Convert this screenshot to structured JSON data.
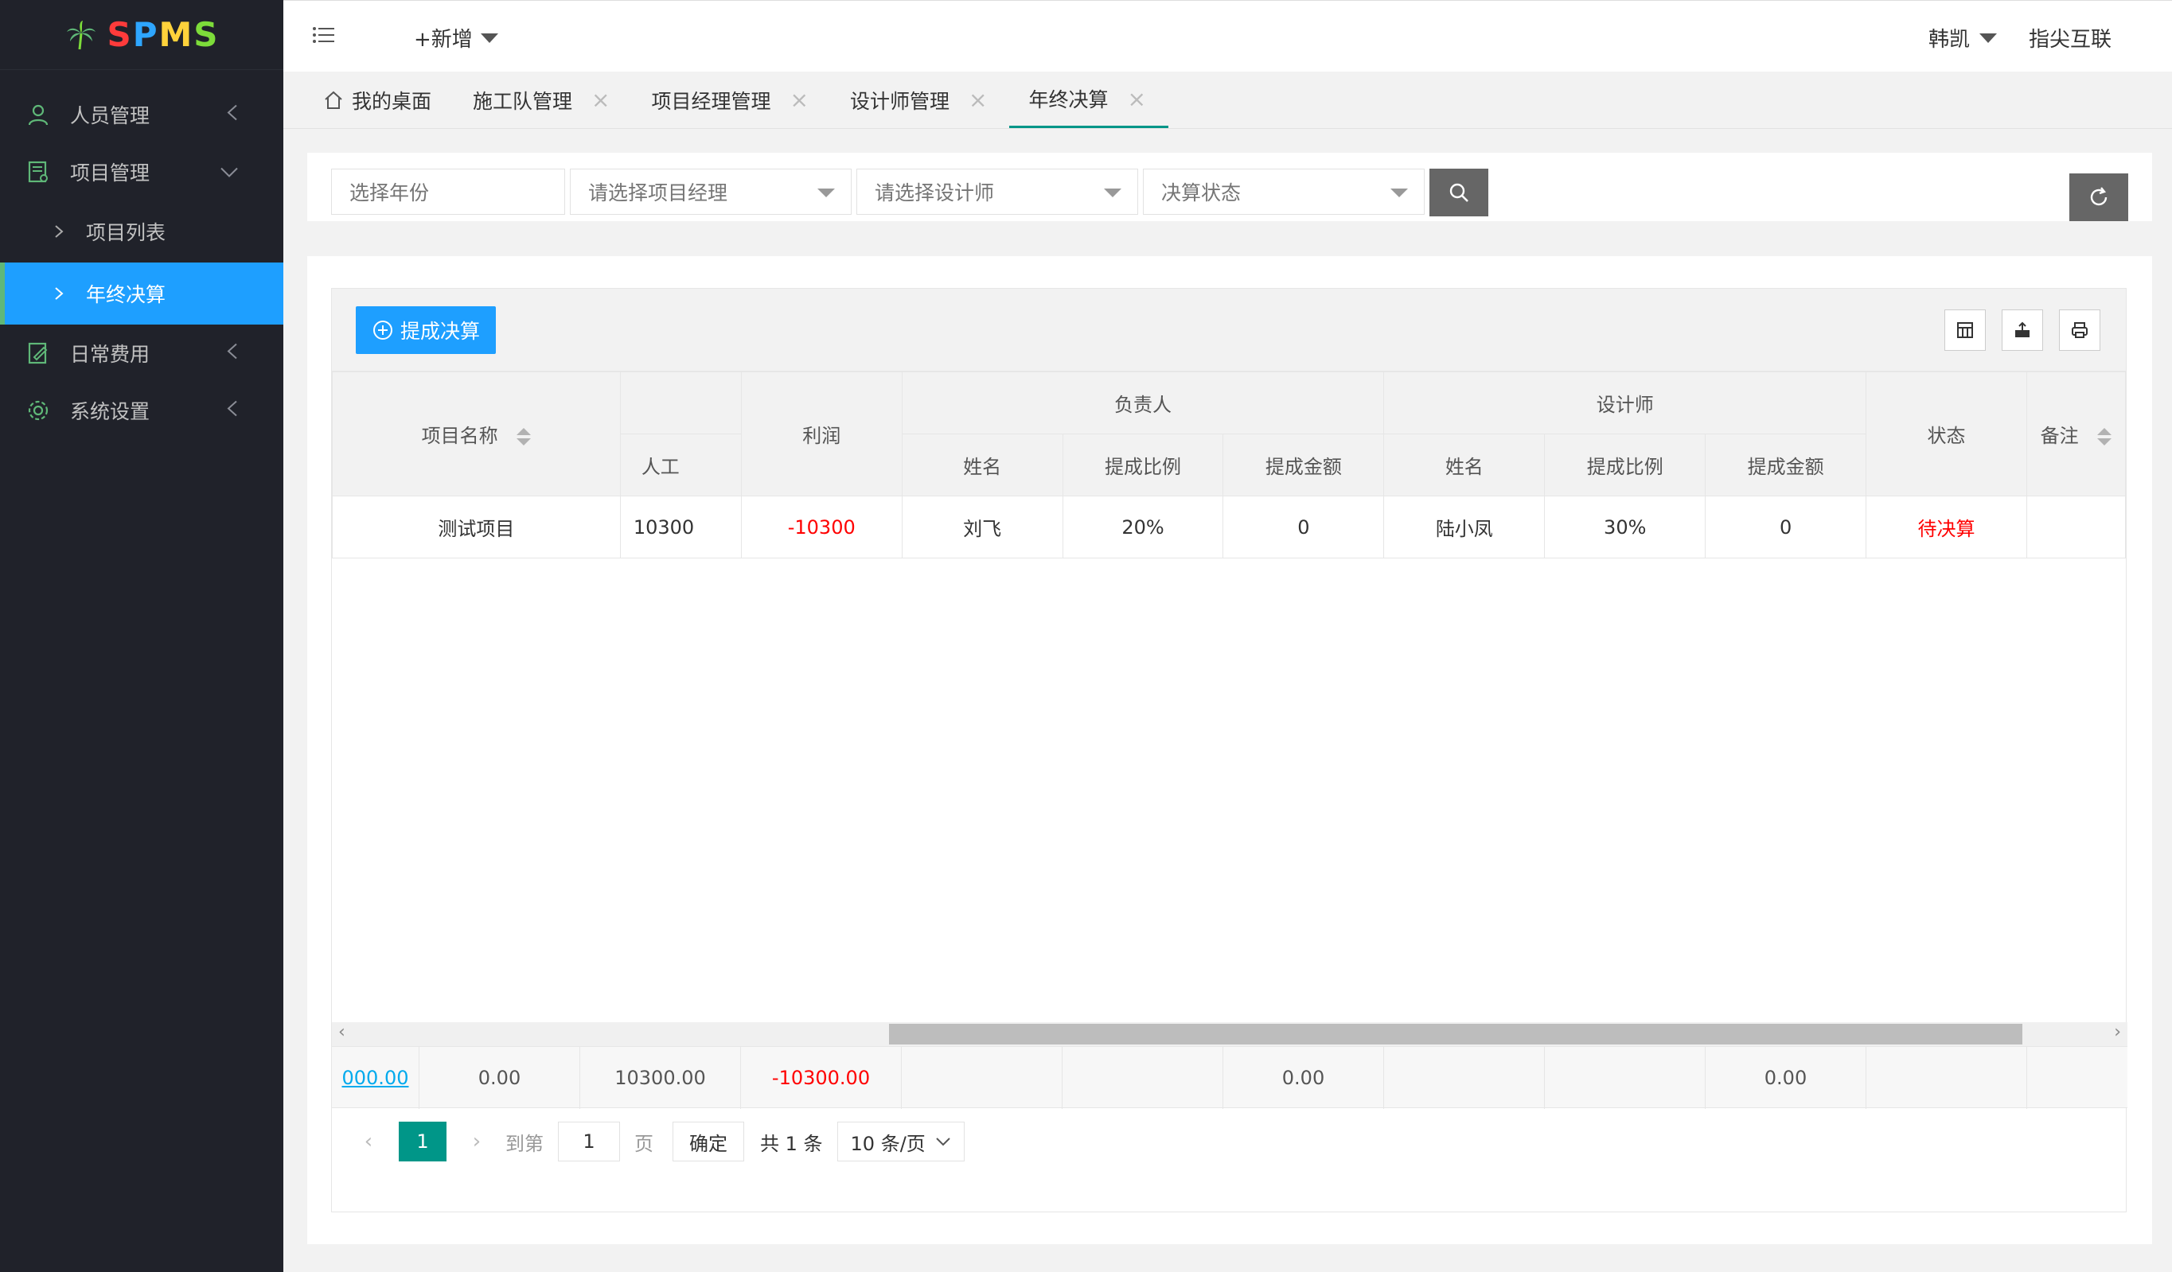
{
  "brand": {
    "logo_text_1": "S",
    "logo_text_2": "P",
    "logo_text_3": "M",
    "logo_text_4": "S"
  },
  "sidebar": {
    "items": [
      {
        "label": "人员管理",
        "icon": "user-icon"
      },
      {
        "label": "项目管理",
        "icon": "project-icon"
      },
      {
        "label": "日常费用",
        "icon": "expense-icon"
      },
      {
        "label": "系统设置",
        "icon": "gear-icon"
      }
    ],
    "sub_items": [
      {
        "label": "项目列表"
      },
      {
        "label": "年终决算"
      }
    ]
  },
  "header": {
    "add_label": "+新增",
    "user_name": "韩凯",
    "org_name": "指尖互联"
  },
  "tabs": [
    {
      "label": "我的桌面"
    },
    {
      "label": "施工队管理"
    },
    {
      "label": "项目经理管理"
    },
    {
      "label": "设计师管理"
    },
    {
      "label": "年终决算"
    }
  ],
  "filters": {
    "year_placeholder": "选择年份",
    "manager_placeholder": "请选择项目经理",
    "designer_placeholder": "请选择设计师",
    "status_placeholder": "决算状态"
  },
  "toolbar": {
    "commission_button": "提成决算"
  },
  "table": {
    "headers": {
      "project_name": "项目名称",
      "labor": "人工",
      "profit": "利润",
      "manager_group": "负责人",
      "designer_group": "设计师",
      "status": "状态",
      "remark": "备注",
      "name": "姓名",
      "ratio": "提成比例",
      "amount": "提成金额"
    },
    "rows": [
      {
        "project_name": "测试项目",
        "labor": "10300",
        "profit": "-10300",
        "manager_name": "刘飞",
        "manager_ratio": "20%",
        "manager_amount": "0",
        "designer_name": "陆小凤",
        "designer_ratio": "30%",
        "designer_amount": "0",
        "status": "待决算",
        "remark": ""
      }
    ],
    "totals": {
      "first": "000.00",
      "second": "0.00",
      "labor": "10300.00",
      "profit": "-10300.00",
      "manager_amount": "0.00",
      "designer_amount": "0.00"
    }
  },
  "pager": {
    "current_page": "1",
    "goto_label": "到第",
    "goto_value": "1",
    "page_unit": "页",
    "confirm": "确定",
    "total": "共 1 条",
    "page_size": "10 条/页"
  },
  "colors": {
    "sidebar_bg": "#20222a",
    "active": "#1e9fff",
    "primary": "#009688",
    "danger": "#ff0000"
  }
}
